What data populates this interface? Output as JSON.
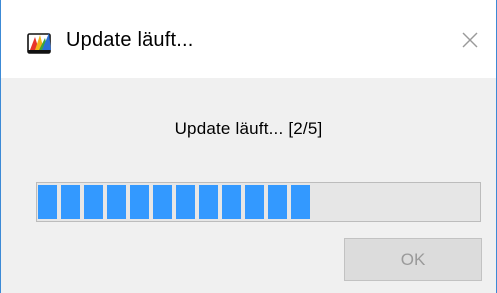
{
  "window": {
    "title": "Update läuft...",
    "app_icon": "colorful-book-icon",
    "close_icon": "close-icon"
  },
  "dialog": {
    "message": "Update läuft... [2/5]",
    "progress_fraction": 0.62,
    "progress_color": "#3399ff",
    "ok_label": "OK",
    "ok_enabled": false
  },
  "colors": {
    "window_bg": "#f0f0f0",
    "titlebar_bg": "#ffffff",
    "desktop_bg": "#0a74c9"
  }
}
